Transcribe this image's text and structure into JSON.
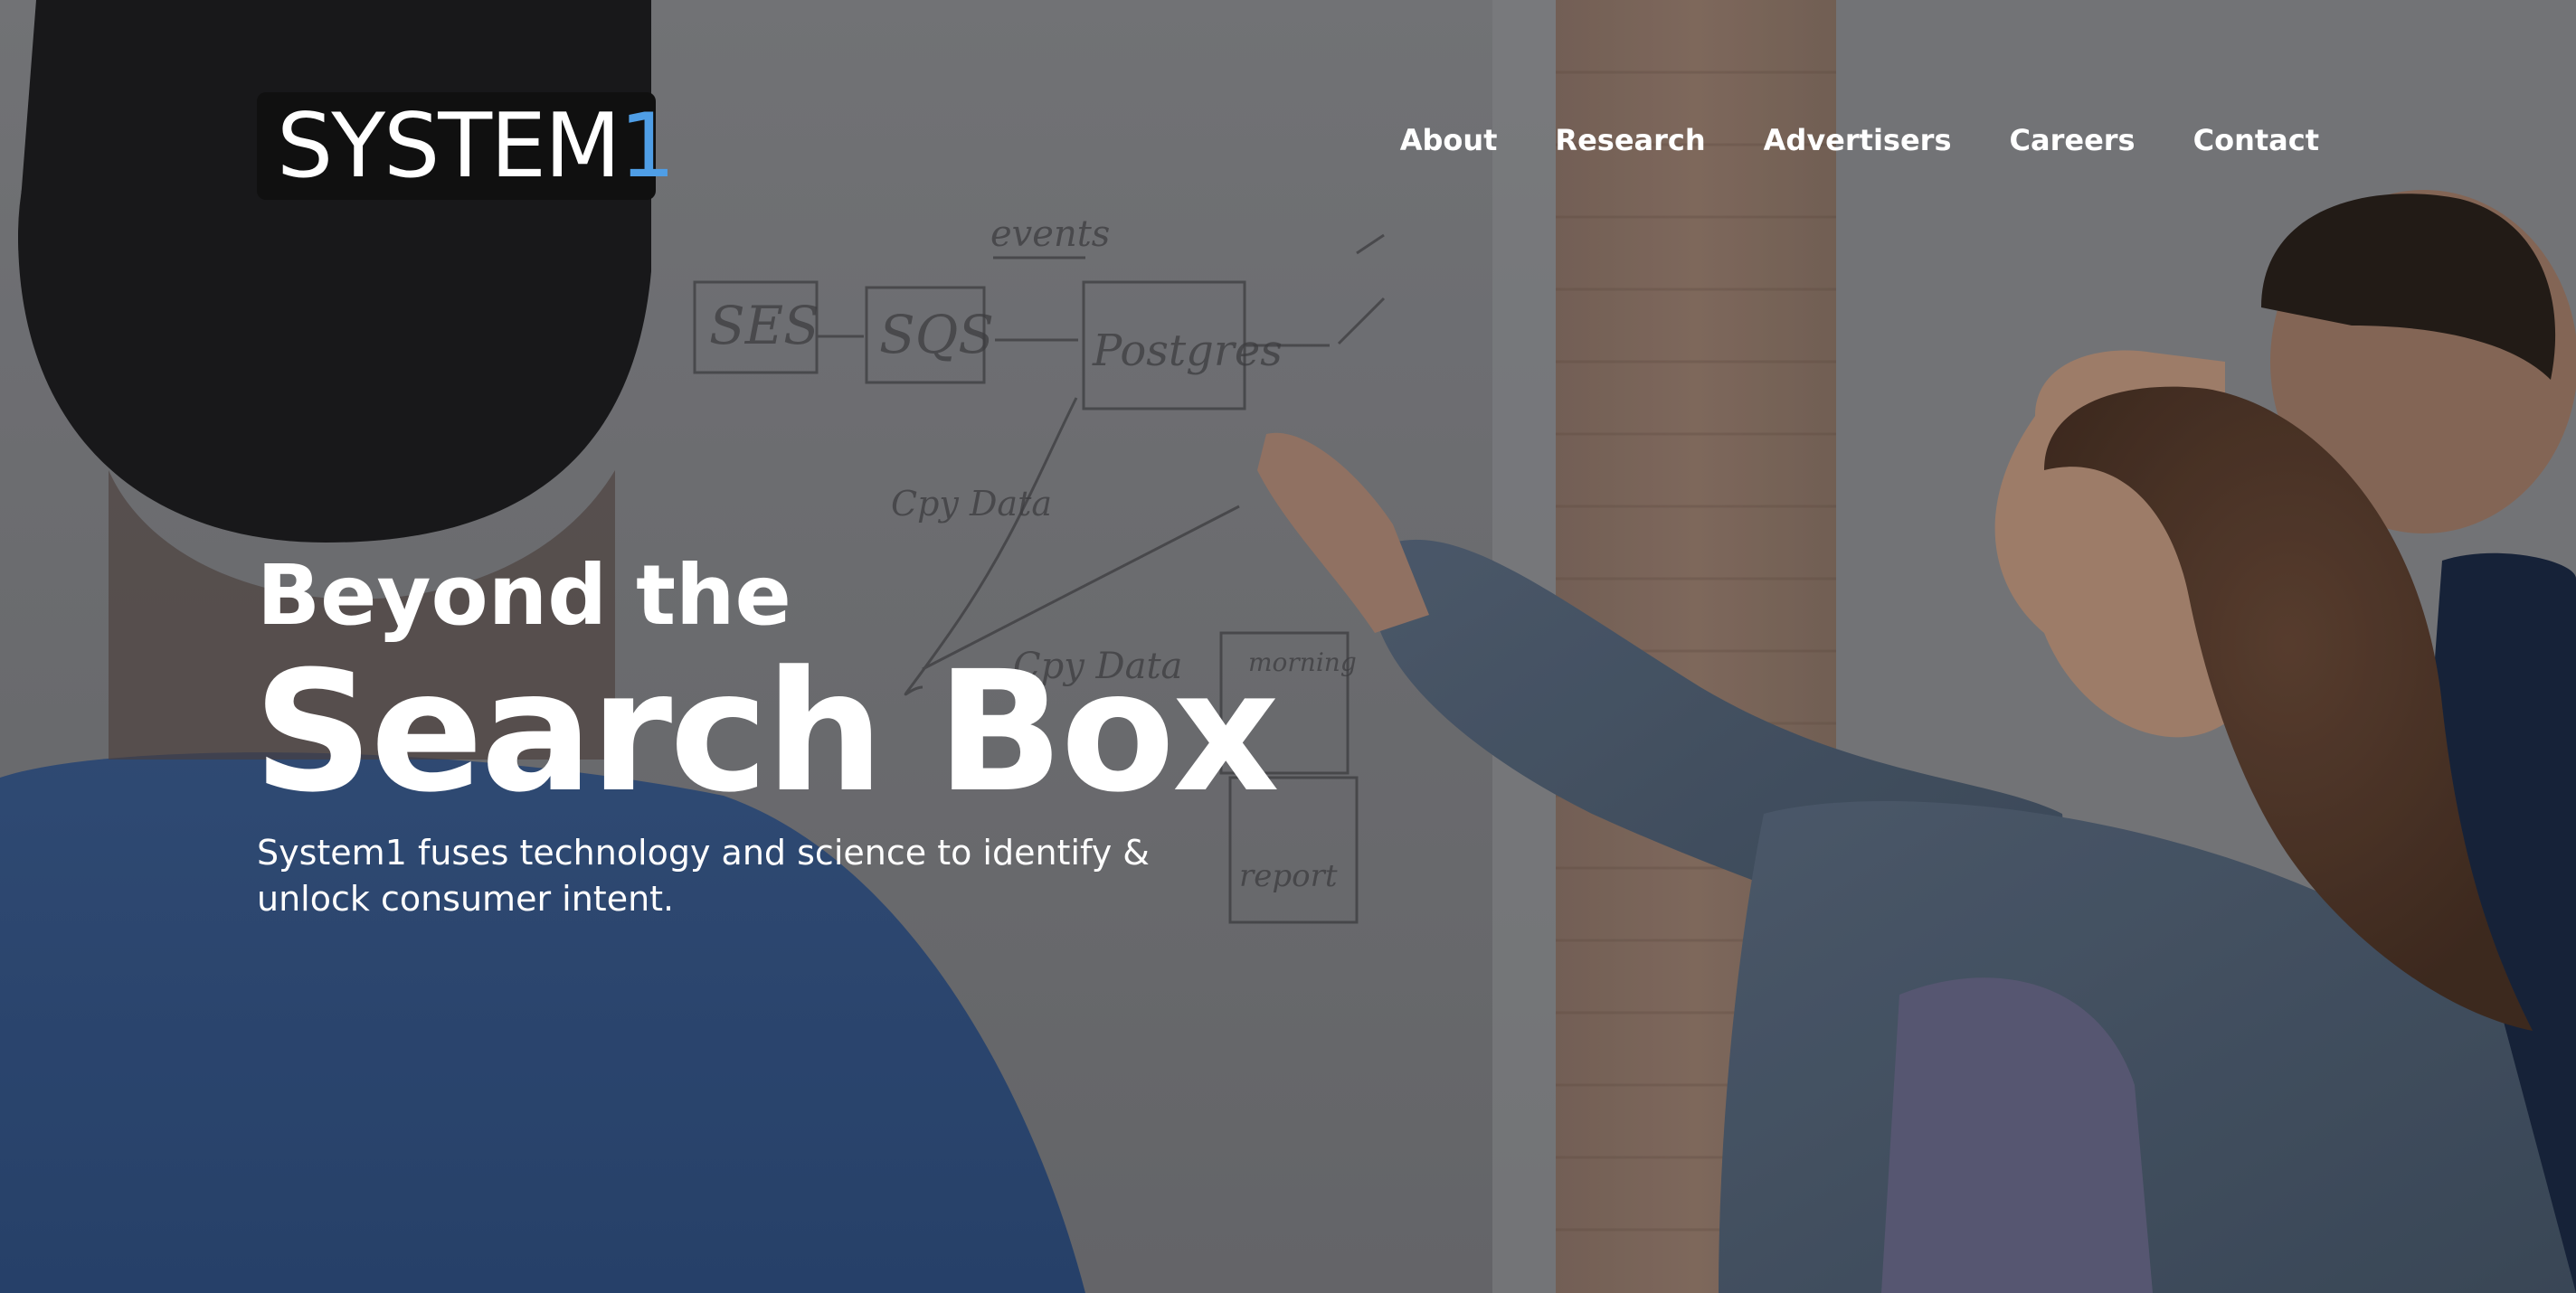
{
  "brand": {
    "logo_main": "SYSTEM",
    "logo_accent": "1",
    "accent_color": "#4f9ee6"
  },
  "nav": {
    "items": [
      {
        "label": "About"
      },
      {
        "label": "Research"
      },
      {
        "label": "Advertisers"
      },
      {
        "label": "Careers"
      },
      {
        "label": "Contact"
      }
    ]
  },
  "hero": {
    "headline_line1": "Beyond the",
    "headline_line2": "Search Box",
    "subtext": "System1 fuses technology and science to identify & unlock consumer intent."
  },
  "whiteboard": {
    "box1": "SES",
    "box2": "SQS",
    "box3": "Postgres",
    "label_events": "events",
    "label_cpy_data": "Cpy Data",
    "label_cpy_data2": "Cpy Data",
    "box_morning": "morning",
    "box_report": "report"
  }
}
